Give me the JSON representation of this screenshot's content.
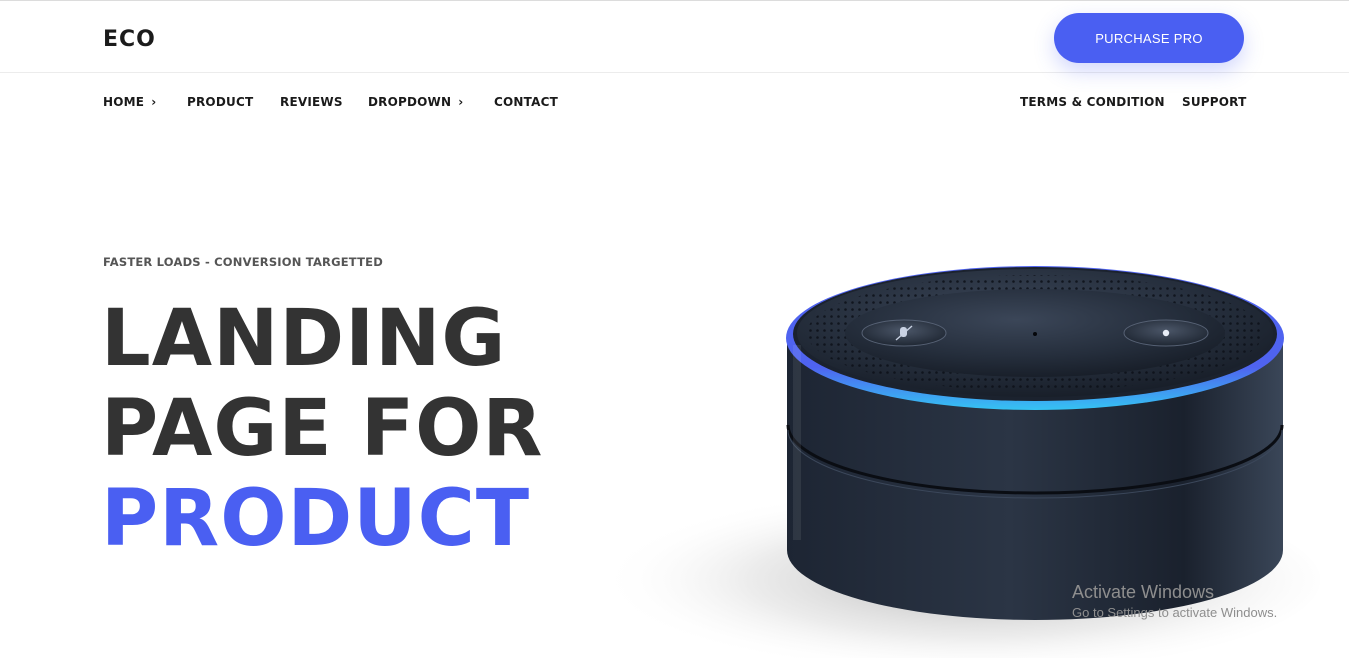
{
  "header": {
    "logo": "ECO",
    "purchase_label": "PURCHASE PRO"
  },
  "nav": {
    "left": [
      {
        "label": "HOME",
        "has_dropdown": true
      },
      {
        "label": "PRODUCT",
        "has_dropdown": false
      },
      {
        "label": "REVIEWS",
        "has_dropdown": false
      },
      {
        "label": "DROPDOWN",
        "has_dropdown": true
      },
      {
        "label": "CONTACT",
        "has_dropdown": false
      }
    ],
    "right": [
      {
        "label": "TERMS & CONDITION"
      },
      {
        "label": "SUPPORT"
      }
    ]
  },
  "hero": {
    "eyebrow": "FASTER LOADS - CONVERSION TARGETTED",
    "line1": "LANDING",
    "line2": "PAGE FOR",
    "line3": "PRODUCT"
  },
  "watermark": {
    "title": "Activate Windows",
    "subtitle": "Go to Settings to activate Windows."
  },
  "colors": {
    "accent": "#4a5ff2",
    "heading": "#333333",
    "speaker_ring": "#4f63f0",
    "speaker_glow": "#35c3f2"
  },
  "icons": {
    "dropdown": "chevron-right-icon",
    "mic_button": "mic-off-icon",
    "action_button": "dot-icon"
  }
}
